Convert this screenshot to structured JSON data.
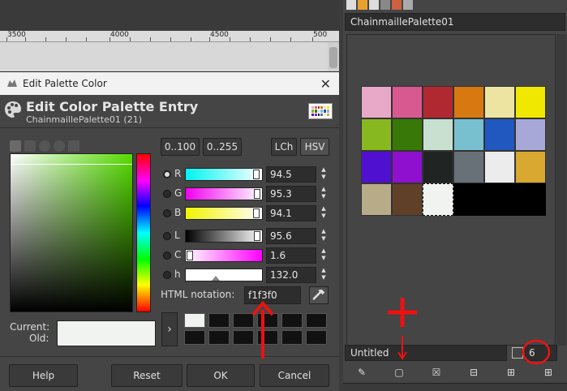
{
  "ruler": {
    "labels": [
      "3500",
      "4000",
      "4500",
      "500"
    ]
  },
  "dialog": {
    "window_title": "Edit Palette Color",
    "heading": "Edit Color Palette Entry",
    "subheading": "ChainmaillePalette01 (21)",
    "range_buttons": [
      "0..100",
      "0..255"
    ],
    "model_buttons": [
      "LCh",
      "HSV"
    ],
    "channels": [
      {
        "letter": "R",
        "value": "94.5",
        "fraction": 0.945
      },
      {
        "letter": "G",
        "value": "95.3",
        "fraction": 0.953
      },
      {
        "letter": "B",
        "value": "94.1",
        "fraction": 0.941
      },
      {
        "letter": "L",
        "value": "95.6",
        "fraction": 0.956
      },
      {
        "letter": "C",
        "value": "1.6",
        "fraction": 0.016
      },
      {
        "letter": "h",
        "value": "132.0",
        "fraction": 0.367
      }
    ],
    "html_label": "HTML notation:",
    "html_value": "f1f3f0",
    "current_label": "Current:",
    "old_label": "Old:",
    "current_color": "#f1f3f0",
    "buttons": {
      "help": "Help",
      "reset": "Reset",
      "ok": "OK",
      "cancel": "Cancel"
    }
  },
  "palette": {
    "name": "ChainmaillePalette01",
    "colors": [
      "#e8a8c8",
      "#d85890",
      "#b02830",
      "#d87810",
      "#ece4a0",
      "#f0e800",
      "#88b820",
      "#387808",
      "#c8e0d0",
      "#78c0d0",
      "#2058c0",
      "#a8a8d8",
      "#5010d0",
      "#9010d0",
      "#202422",
      "#687078",
      "#ececec",
      "#d8a830",
      "#b8ac88",
      "#604028",
      "#f1f3f0"
    ],
    "selected_index": 20,
    "footer_name": "Untitled",
    "columns": "6"
  }
}
